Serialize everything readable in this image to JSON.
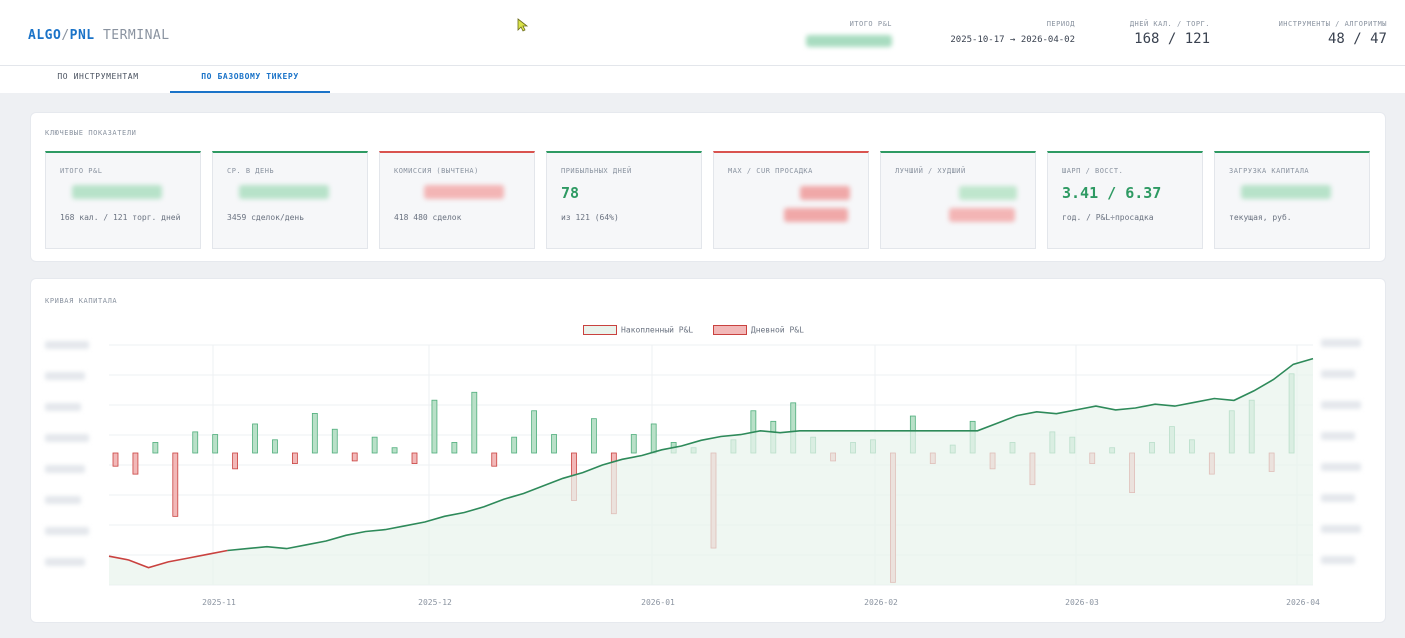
{
  "header": {
    "brand_algo": "ALGO",
    "brand_slash": "/",
    "brand_pnl": "PNL",
    "brand_terminal": "TERMINAL",
    "stats": [
      {
        "label": "ИТОГО P&L",
        "value": ""
      },
      {
        "label": "ПЕРИОД",
        "value": "2025-10-17 → 2026-04-02"
      },
      {
        "label": "ДНЕЙ КАЛ. / ТОРГ.",
        "value": "168 / 121"
      },
      {
        "label": "ИНСТРУМЕНТЫ / АЛГОРИТМЫ",
        "value": "48 / 47"
      }
    ]
  },
  "tabs": [
    {
      "label": "ПО ИНСТРУМЕНТАМ",
      "active": false
    },
    {
      "label": "ПО БАЗОВОМУ ТИКЕРУ",
      "active": true
    }
  ],
  "kpi": {
    "title": "КЛЮЧЕВЫЕ ПОКАЗАТЕЛИ",
    "cards": [
      {
        "label": "ИТОГО P&L",
        "value": "",
        "sub": "168 кал. / 121 торг. дней",
        "accent": "#2e9a63",
        "blur": "green"
      },
      {
        "label": "СР. В ДЕНЬ",
        "value": "",
        "sub": "3459 сделок/день",
        "accent": "#2e9a63",
        "blur": "green"
      },
      {
        "label": "КОМИССИЯ (ВЫЧТЕНА)",
        "value": "",
        "sub": "418 480 сделок",
        "accent": "#d9534f",
        "blur": "red"
      },
      {
        "label": "ПРИБЫЛЬНЫХ ДНЕЙ",
        "value": "78",
        "sub": "из 121 (64%)",
        "accent": "#2e9a63",
        "blur": ""
      },
      {
        "label": "MAX / CUR ПРОСАДКА",
        "value": "",
        "sub": "",
        "accent": "#d9534f",
        "blur": "red2"
      },
      {
        "label": "ЛУЧШИЙ / ХУДШИЙ",
        "value": "",
        "sub": "",
        "accent": "#2e9a63",
        "blur": "mixed"
      },
      {
        "label": "ШАРП / ВОССТ.",
        "value": "3.41 / 6.37",
        "sub": "год. / P&L÷просадка",
        "accent": "#2e9a63",
        "blur": ""
      },
      {
        "label": "ЗАГРУЗКА КАПИТАЛА",
        "value": "",
        "sub": "текущая, руб.",
        "accent": "#2e9a63",
        "blur": "green"
      }
    ]
  },
  "equity": {
    "title": "КРИВАЯ КАПИТАЛА",
    "legend": [
      {
        "label": "Накопленный P&L",
        "fill": "#e9f3ec",
        "border": "#c9423f"
      },
      {
        "label": "Дневной P&L",
        "fill": "#f2b8b8",
        "border": "#c9423f"
      }
    ]
  },
  "chart_data": {
    "type": "bar",
    "x_tick_labels": [
      "2025-11",
      "2025-12",
      "2026-01",
      "2026-02",
      "2026-03",
      "2026-04"
    ],
    "grid": true,
    "series": [
      {
        "name": "Накопленный P&L",
        "type": "line",
        "values": [
          -0.8,
          -1.0,
          -1.4,
          -1.1,
          -0.9,
          -0.7,
          -0.5,
          -0.4,
          -0.3,
          -0.4,
          -0.2,
          0.0,
          0.3,
          0.5,
          0.6,
          0.8,
          1.0,
          1.3,
          1.5,
          1.8,
          2.2,
          2.5,
          2.9,
          3.3,
          3.6,
          4.0,
          4.3,
          4.5,
          4.8,
          5.0,
          5.3,
          5.5,
          5.6,
          5.8,
          5.7,
          5.8,
          5.8,
          5.8,
          5.8,
          5.8,
          5.8,
          5.8,
          5.8,
          5.8,
          5.8,
          6.2,
          6.6,
          6.8,
          6.7,
          6.9,
          7.1,
          6.9,
          7.0,
          7.2,
          7.1,
          7.3,
          7.5,
          7.4,
          7.9,
          8.5,
          9.3,
          9.6
        ]
      },
      {
        "name": "Дневной P&L",
        "type": "bar",
        "values": [
          -0.5,
          -0.8,
          0.4,
          -2.4,
          0.8,
          0.7,
          -0.6,
          1.1,
          0.5,
          -0.4,
          1.5,
          0.9,
          -0.3,
          0.6,
          0.2,
          -0.4,
          2.0,
          0.4,
          2.3,
          -0.5,
          0.6,
          1.6,
          0.7,
          -1.8,
          1.3,
          -2.3,
          0.7,
          1.1,
          0.4,
          0.2,
          -3.6,
          0.5,
          1.6,
          1.2,
          1.9,
          0.6,
          -0.3,
          0.4,
          0.5,
          -4.9,
          1.4,
          -0.4,
          0.3,
          1.2,
          -0.6,
          0.4,
          -1.2,
          0.8,
          0.6,
          -0.4,
          0.2,
          -1.5,
          0.4,
          1.0,
          0.5,
          -0.8,
          1.6,
          2.0,
          -0.7,
          3.0
        ]
      }
    ]
  }
}
